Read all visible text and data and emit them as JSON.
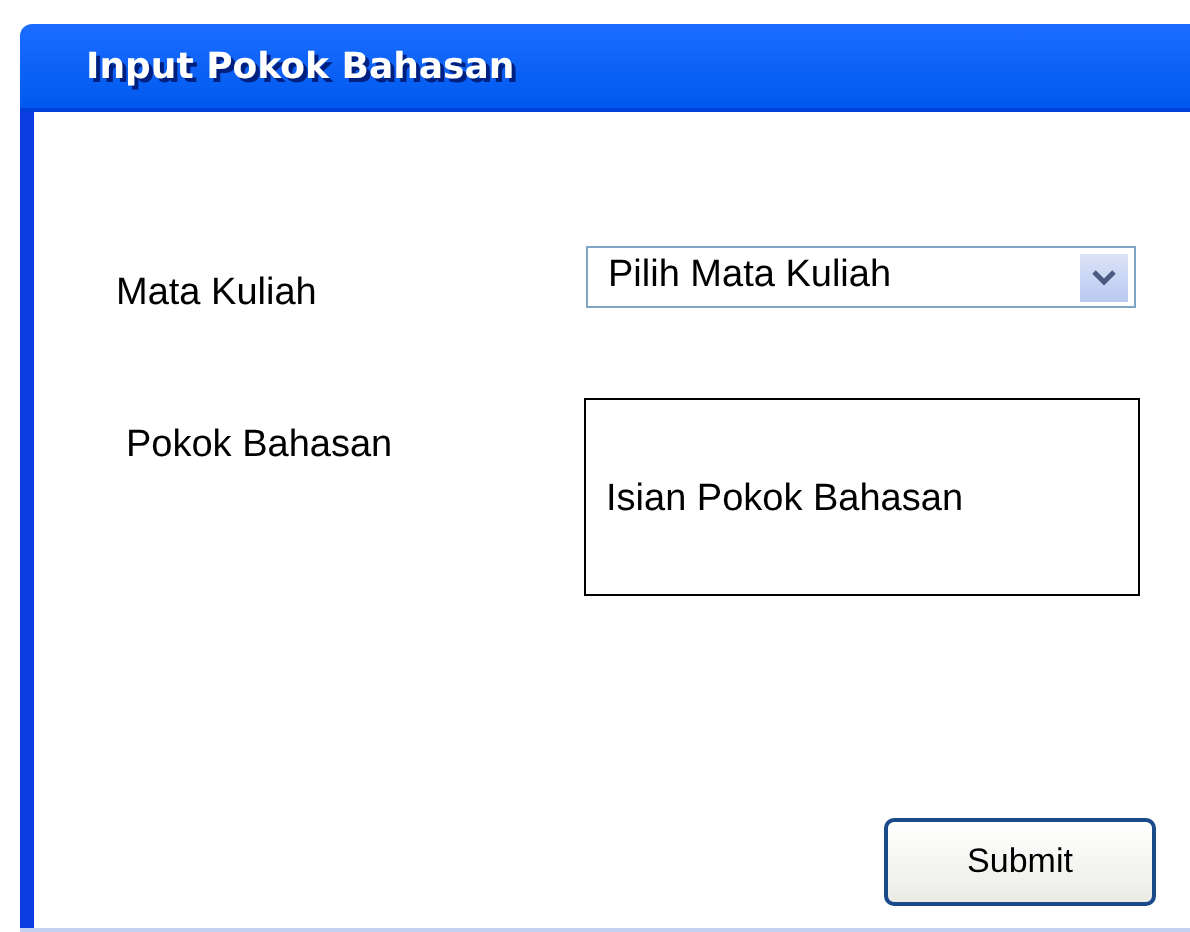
{
  "window": {
    "title": "Input Pokok Bahasan"
  },
  "form": {
    "course_label": "Mata Kuliah",
    "course_select": {
      "value": "Pilih Mata Kuliah"
    },
    "topic_label": "Pokok Bahasan",
    "topic_field": {
      "placeholder": "Isian Pokok Bahasan"
    }
  },
  "buttons": [
    {
      "label": "Submit"
    }
  ]
}
